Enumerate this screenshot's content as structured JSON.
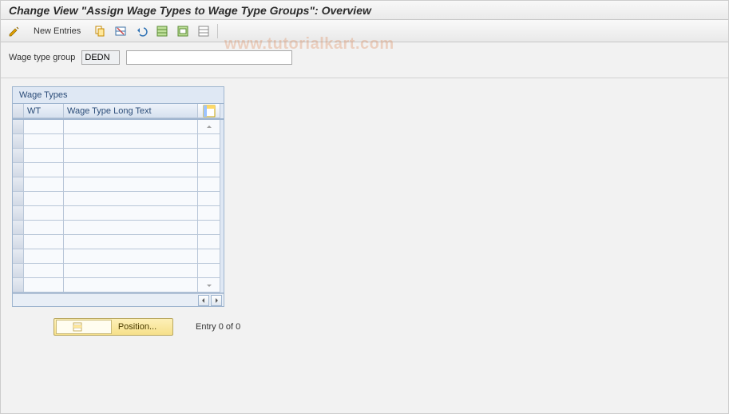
{
  "title": "Change View \"Assign Wage Types to Wage Type Groups\": Overview",
  "toolbar": {
    "new_entries_label": "New Entries"
  },
  "filter": {
    "label": "Wage type group",
    "code_value": "DEDN",
    "desc_value": ""
  },
  "table": {
    "caption": "Wage Types",
    "col_wt": "WT",
    "col_long": "Wage Type Long Text",
    "rows": [
      {
        "wt": "",
        "text": ""
      },
      {
        "wt": "",
        "text": ""
      },
      {
        "wt": "",
        "text": ""
      },
      {
        "wt": "",
        "text": ""
      },
      {
        "wt": "",
        "text": ""
      },
      {
        "wt": "",
        "text": ""
      },
      {
        "wt": "",
        "text": ""
      },
      {
        "wt": "",
        "text": ""
      },
      {
        "wt": "",
        "text": ""
      },
      {
        "wt": "",
        "text": ""
      },
      {
        "wt": "",
        "text": ""
      },
      {
        "wt": "",
        "text": ""
      }
    ]
  },
  "position_label": "Position...",
  "entry_label": "Entry 0 of 0",
  "watermark": "www.tutorialkart.com"
}
